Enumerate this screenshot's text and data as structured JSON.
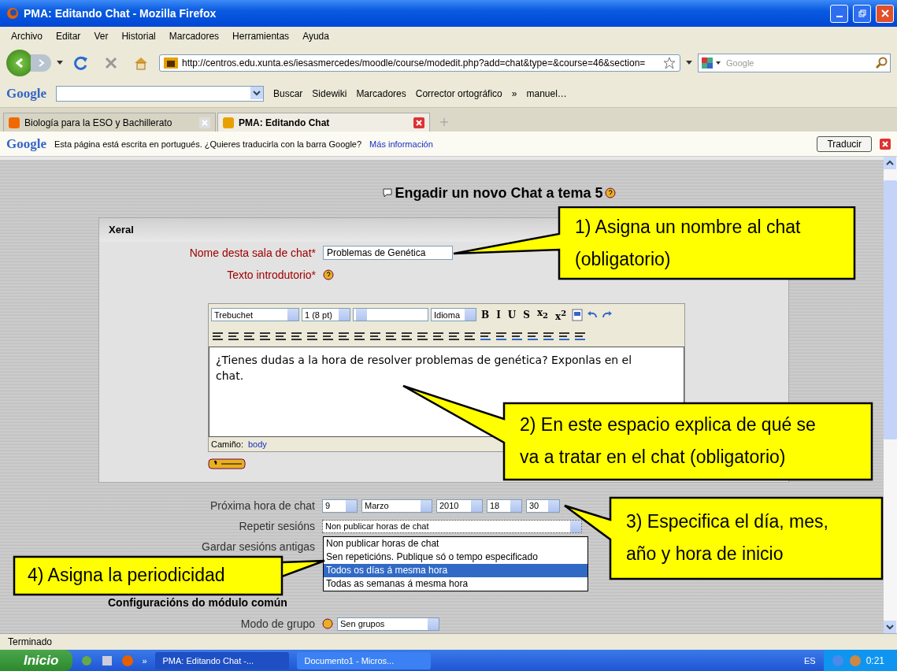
{
  "window": {
    "title": "PMA: Editando Chat - Mozilla Firefox"
  },
  "menu": [
    "Archivo",
    "Editar",
    "Ver",
    "Historial",
    "Marcadores",
    "Herramientas",
    "Ayuda"
  ],
  "navigation": {
    "url": "http://centros.edu.xunta.es/iesasmercedes/moodle/course/modedit.php?add=chat&type=&course=46&section=",
    "search_placeholder": "Google"
  },
  "google_toolbar": {
    "logo": "Google",
    "items": [
      "Buscar",
      "Sidewiki",
      "Marcadores",
      "Corrector ortográfico",
      "»",
      "manuel…"
    ]
  },
  "tabs": [
    {
      "label": "Biología para la ESO y Bachillerato",
      "selected": false
    },
    {
      "label": "PMA: Editando Chat",
      "selected": true
    }
  ],
  "translate_bar": {
    "logo": "Google",
    "message": "Esta página está escrita en portugués. ¿Quieres traducirla con la barra Google?",
    "link": "Más información",
    "button": "Traducir"
  },
  "page": {
    "heading": "Engadir un novo Chat a tema 5",
    "section": "Xeral",
    "name_label": "Nome desta sala de chat*",
    "name_value": "Problemas de Genética",
    "intro_label": "Texto introdutorio*",
    "editor": {
      "font": "Trebuchet",
      "size": "1 (8 pt)",
      "language": "Idioma",
      "text_buttons": [
        "B",
        "I",
        "U",
        "S",
        "x$_{2}$",
        "x$^{2}$"
      ],
      "content": "¿Tienes dudas a la hora de resolver problemas de genética? Exponlas en el chat.",
      "path_label": "Camiño:",
      "path": "body"
    },
    "next_chat_label": "Próxima hora de chat",
    "next_chat": [
      "9",
      "Marzo",
      "2010",
      "18",
      "30"
    ],
    "repeat_label": "Repetir sesións",
    "repeat_value": "Non publicar horas de chat",
    "repeat_options": [
      {
        "label": "Non publicar horas de chat",
        "selected": false
      },
      {
        "label": "Sen repeticións. Publique só o tempo especificado",
        "selected": false
      },
      {
        "label": "Todos os días á mesma hora",
        "selected": true
      },
      {
        "label": "Todas as semanas á mesma hora",
        "selected": false
      }
    ],
    "keep_label": "Gardar sesións antigas",
    "section2": "Configuracións do módulo común",
    "group_label": "Modo de grupo",
    "group_value": "Sen grupos"
  },
  "callouts": [
    {
      "kind": "top",
      "lines": [
        "1) Asigna un nombre al chat",
        "(obligatorio)"
      ]
    },
    {
      "kind": "editor",
      "lines": [
        "2) En este espacio explica de qué se",
        "va a tratar  en el chat (obligatorio)"
      ]
    },
    {
      "kind": "date",
      "lines": [
        "3) Especifica el día, mes,",
        "año y hora de inicio"
      ]
    },
    {
      "kind": "repeat",
      "lines": [
        "4) Asigna la periodicidad"
      ]
    }
  ],
  "status_bar": "Terminado",
  "taskbar": {
    "start": "Inicio",
    "more": "»",
    "tasks": [
      "PMA: Editando Chat -...",
      "Documento1 - Micros..."
    ],
    "language": "ES",
    "clock": "0:21"
  }
}
